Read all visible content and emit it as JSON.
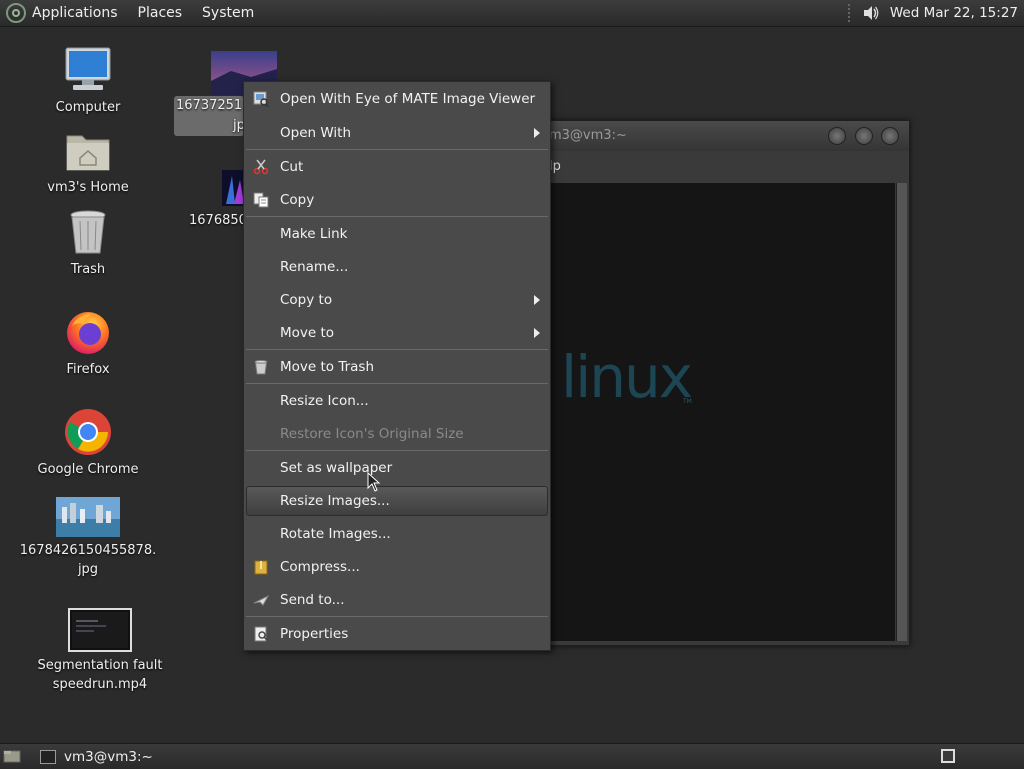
{
  "top_panel": {
    "menus": [
      "Applications",
      "Places",
      "System"
    ],
    "clock": "Wed Mar 22, 15:27",
    "icons": [
      "mate-menu-icon",
      "volume-icon"
    ]
  },
  "desktop": {
    "computer": "Computer",
    "home": "vm3's Home",
    "trash": "Trash",
    "firefox": "Firefox",
    "chrome": "Google Chrome",
    "image_file_line1": "1678426150455878.",
    "image_file_line2": "jpg",
    "video_line1": "Segmentation fault",
    "video_line2": "speedrun.mp4",
    "selected_file_line1": "16737251",
    "selected_file_line2": "jp",
    "other_file": "1676850"
  },
  "terminal": {
    "title": "m3@vm3:~",
    "menu_partial": "lp",
    "logo_text": "linux",
    "logo_tm": "TM"
  },
  "context_menu": {
    "items": [
      {
        "label": "Open With Eye of MATE Image Viewer",
        "icon": "image-viewer-icon"
      },
      {
        "label": "Open With",
        "submenu": true
      },
      {
        "label": "Cut",
        "icon": "scissors-icon"
      },
      {
        "label": "Copy",
        "icon": "copy-icon"
      },
      {
        "label": "Make Link"
      },
      {
        "label": "Rename..."
      },
      {
        "label": "Copy to",
        "submenu": true
      },
      {
        "label": "Move to",
        "submenu": true
      },
      {
        "label": "Move to Trash",
        "icon": "trash-icon"
      },
      {
        "label": "Resize Icon..."
      },
      {
        "label": "Restore Icon's Original Size",
        "disabled": true
      },
      {
        "label": "Set as wallpaper"
      },
      {
        "label": "Resize Images...",
        "highlighted": true
      },
      {
        "label": "Rotate Images..."
      },
      {
        "label": "Compress...",
        "icon": "archive-icon"
      },
      {
        "label": "Send to...",
        "icon": "send-icon"
      },
      {
        "label": "Properties",
        "icon": "properties-icon"
      }
    ]
  },
  "bottom_panel": {
    "task_label": "vm3@vm3:~"
  }
}
